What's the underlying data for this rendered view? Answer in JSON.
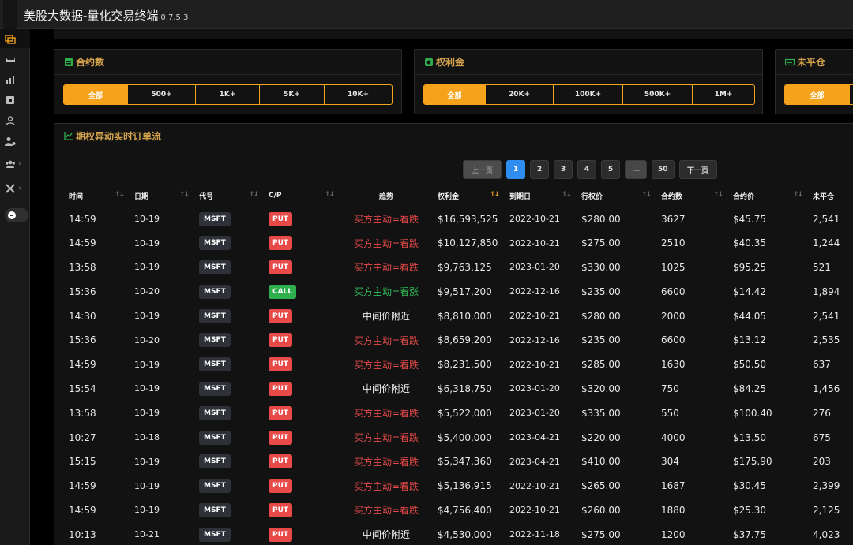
{
  "app": {
    "title": "美股大数据-量化交易终端",
    "version": "0.7.5.3"
  },
  "sidebar": {
    "items": [
      {
        "icon": "options-flow-icon"
      },
      {
        "icon": "whale-icon"
      },
      {
        "icon": "chart-icon"
      },
      {
        "icon": "calendar-icon"
      },
      {
        "icon": "user-icon"
      },
      {
        "icon": "user-settings-icon"
      },
      {
        "icon": "group-icon"
      },
      {
        "icon": "tools-icon"
      }
    ]
  },
  "filters": {
    "contracts": {
      "title": "合约数",
      "options": [
        "全部",
        "500+",
        "1K+",
        "5K+",
        "10K+"
      ],
      "selected": "全部"
    },
    "premium": {
      "title": "权利金",
      "options": [
        "全部",
        "20K+",
        "100K+",
        "500K+",
        "1M+"
      ],
      "selected": "全部"
    },
    "open_interest": {
      "title": "未平仓",
      "options": [
        "全部"
      ],
      "selected": "全部"
    }
  },
  "flow": {
    "title": "期权异动实时订单流",
    "pagination": {
      "prev": "上一页",
      "pages": [
        "1",
        "2",
        "3",
        "4",
        "5"
      ],
      "ellipsis": "...",
      "last": "50",
      "next": "下一页",
      "current": "1"
    },
    "columns": [
      "时间",
      "日期",
      "代号",
      "C/P",
      "趋势",
      "权利金",
      "到期日",
      "行权价",
      "合约数",
      "合约价",
      "未平仓"
    ],
    "sorted_column": "权利金",
    "rows": [
      {
        "time": "14:59",
        "date": "10-19",
        "symbol": "MSFT",
        "cp": "PUT",
        "trend": "买方主动=看跌",
        "trend_type": "down",
        "premium": "$16,593,525",
        "expiry": "2022-10-21",
        "strike": "$280.00",
        "contracts": "3627",
        "price": "$45.75",
        "oi": "2,541"
      },
      {
        "time": "14:59",
        "date": "10-19",
        "symbol": "MSFT",
        "cp": "PUT",
        "trend": "买方主动=看跌",
        "trend_type": "down",
        "premium": "$10,127,850",
        "expiry": "2022-10-21",
        "strike": "$275.00",
        "contracts": "2510",
        "price": "$40.35",
        "oi": "1,244"
      },
      {
        "time": "13:58",
        "date": "10-19",
        "symbol": "MSFT",
        "cp": "PUT",
        "trend": "买方主动=看跌",
        "trend_type": "down",
        "premium": "$9,763,125",
        "expiry": "2023-01-20",
        "strike": "$330.00",
        "contracts": "1025",
        "price": "$95.25",
        "oi": "521"
      },
      {
        "time": "15:36",
        "date": "10-20",
        "symbol": "MSFT",
        "cp": "CALL",
        "trend": "买方主动=看涨",
        "trend_type": "up",
        "premium": "$9,517,200",
        "expiry": "2022-12-16",
        "strike": "$235.00",
        "contracts": "6600",
        "price": "$14.42",
        "oi": "1,894"
      },
      {
        "time": "14:30",
        "date": "10-19",
        "symbol": "MSFT",
        "cp": "PUT",
        "trend": "中间价附近",
        "trend_type": "mid",
        "premium": "$8,810,000",
        "expiry": "2022-10-21",
        "strike": "$280.00",
        "contracts": "2000",
        "price": "$44.05",
        "oi": "2,541"
      },
      {
        "time": "15:36",
        "date": "10-20",
        "symbol": "MSFT",
        "cp": "PUT",
        "trend": "买方主动=看跌",
        "trend_type": "down",
        "premium": "$8,659,200",
        "expiry": "2022-12-16",
        "strike": "$235.00",
        "contracts": "6600",
        "price": "$13.12",
        "oi": "2,535"
      },
      {
        "time": "14:59",
        "date": "10-19",
        "symbol": "MSFT",
        "cp": "PUT",
        "trend": "买方主动=看跌",
        "trend_type": "down",
        "premium": "$8,231,500",
        "expiry": "2022-10-21",
        "strike": "$285.00",
        "contracts": "1630",
        "price": "$50.50",
        "oi": "637"
      },
      {
        "time": "15:54",
        "date": "10-19",
        "symbol": "MSFT",
        "cp": "PUT",
        "trend": "中间价附近",
        "trend_type": "mid",
        "premium": "$6,318,750",
        "expiry": "2023-01-20",
        "strike": "$320.00",
        "contracts": "750",
        "price": "$84.25",
        "oi": "1,456"
      },
      {
        "time": "13:58",
        "date": "10-19",
        "symbol": "MSFT",
        "cp": "PUT",
        "trend": "买方主动=看跌",
        "trend_type": "down",
        "premium": "$5,522,000",
        "expiry": "2023-01-20",
        "strike": "$335.00",
        "contracts": "550",
        "price": "$100.40",
        "oi": "276"
      },
      {
        "time": "10:27",
        "date": "10-18",
        "symbol": "MSFT",
        "cp": "PUT",
        "trend": "买方主动=看跌",
        "trend_type": "down",
        "premium": "$5,400,000",
        "expiry": "2023-04-21",
        "strike": "$220.00",
        "contracts": "4000",
        "price": "$13.50",
        "oi": "675"
      },
      {
        "time": "15:15",
        "date": "10-19",
        "symbol": "MSFT",
        "cp": "PUT",
        "trend": "买方主动=看跌",
        "trend_type": "down",
        "premium": "$5,347,360",
        "expiry": "2023-04-21",
        "strike": "$410.00",
        "contracts": "304",
        "price": "$175.90",
        "oi": "203"
      },
      {
        "time": "14:59",
        "date": "10-19",
        "symbol": "MSFT",
        "cp": "PUT",
        "trend": "买方主动=看跌",
        "trend_type": "down",
        "premium": "$5,136,915",
        "expiry": "2022-10-21",
        "strike": "$265.00",
        "contracts": "1687",
        "price": "$30.45",
        "oi": "2,399"
      },
      {
        "time": "14:59",
        "date": "10-19",
        "symbol": "MSFT",
        "cp": "PUT",
        "trend": "买方主动=看跌",
        "trend_type": "down",
        "premium": "$4,756,400",
        "expiry": "2022-10-21",
        "strike": "$260.00",
        "contracts": "1880",
        "price": "$25.30",
        "oi": "2,125"
      },
      {
        "time": "10:13",
        "date": "10-21",
        "symbol": "MSFT",
        "cp": "PUT",
        "trend": "中间价附近",
        "trend_type": "mid",
        "premium": "$4,530,000",
        "expiry": "2022-11-18",
        "strike": "$275.00",
        "contracts": "1200",
        "price": "$37.75",
        "oi": "4,023"
      }
    ]
  },
  "colors": {
    "accent": "#f5a31a",
    "pager_active": "#2f8df0",
    "put": "#e84a4a",
    "call": "#2fae4e",
    "bearish": "#e84a4a",
    "bullish": "#2fbf5a"
  }
}
